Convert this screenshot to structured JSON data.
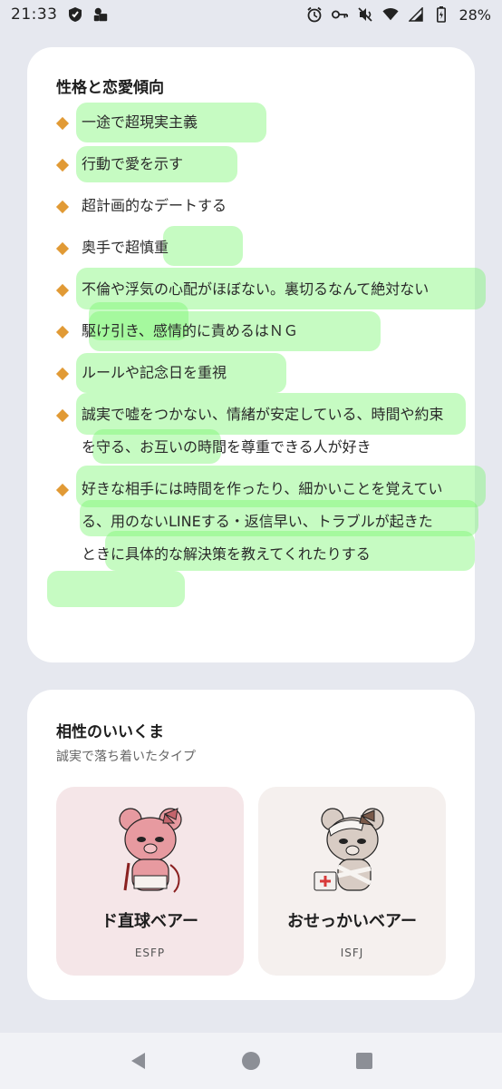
{
  "status_bar": {
    "time": "21:33",
    "battery": "28%",
    "left_icons": [
      "shield-icon",
      "game-icon"
    ],
    "right_icons": [
      "alarm-icon",
      "vpn-key-icon",
      "mute-icon",
      "wifi-icon",
      "signal-icon",
      "battery-icon"
    ]
  },
  "personality": {
    "title": "性格と恋愛傾向",
    "items": [
      {
        "text": "一途で超現実主義"
      },
      {
        "text": "行動で愛を示す"
      },
      {
        "text": "超計画的なデートする"
      },
      {
        "text": "奥手で超慎重"
      },
      {
        "text": "不倫や浮気の心配がほぼない。裏切るなんて絶対ない"
      },
      {
        "text": "駆け引き、感情的に責めるはＮＧ"
      },
      {
        "text": "ルールや記念日を重視"
      },
      {
        "text": "誠実で嘘をつかない、情緒が安定している、時間や約束を守る、お互いの時間を尊重できる人が好き"
      },
      {
        "text": "好きな相手には時間を作ったり、細かいことを覚えている、用のないLINEする・返信早い、トラブルが起きたときに具体的な解決策を教えてくれたりする"
      }
    ],
    "bullet_color": "#e19a35",
    "highlight_color": "#78f56e"
  },
  "compatibility": {
    "title": "相性のいいくま",
    "subtitle": "誠実で落ち着いたタイプ",
    "types": [
      {
        "name": "ド直球ベアー",
        "code": "ESFP",
        "illustration": "pink-bear-illustration"
      },
      {
        "name": "おせっかいベアー",
        "code": "ISFJ",
        "illustration": "bandaged-bear-illustration"
      }
    ]
  },
  "nav_bar": {
    "buttons": [
      "back-icon",
      "home-icon",
      "recents-icon"
    ]
  }
}
